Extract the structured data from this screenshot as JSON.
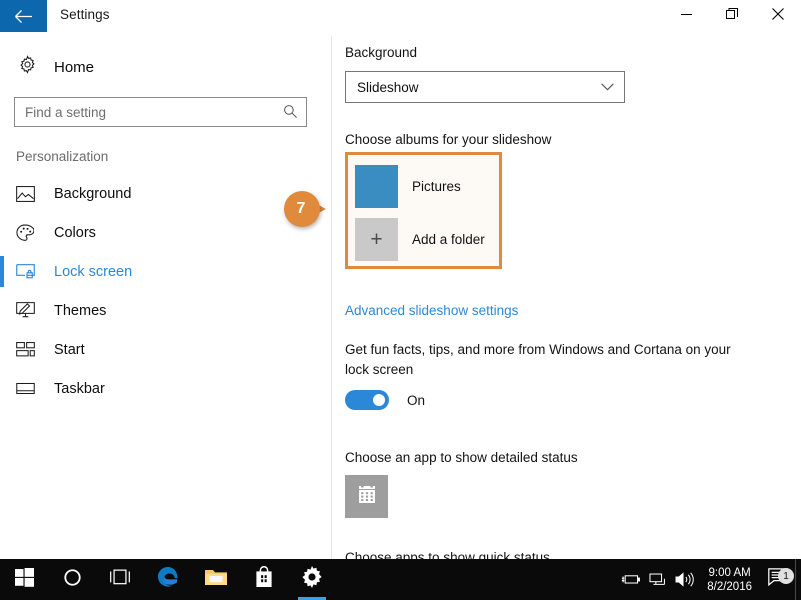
{
  "window": {
    "title": "Settings",
    "back_icon": "back-arrow-icon",
    "minimize_label": "Minimize",
    "restore_label": "Restore",
    "close_label": "Close"
  },
  "sidebar": {
    "home_label": "Home",
    "home_icon": "gear-icon",
    "search": {
      "placeholder": "Find a setting",
      "value": "",
      "icon": "search-icon"
    },
    "section_title": "Personalization",
    "items": [
      {
        "label": "Background",
        "icon": "picture-icon",
        "selected": false
      },
      {
        "label": "Colors",
        "icon": "palette-icon",
        "selected": false
      },
      {
        "label": "Lock screen",
        "icon": "lock-screen-icon",
        "selected": true
      },
      {
        "label": "Themes",
        "icon": "brush-icon",
        "selected": false
      },
      {
        "label": "Start",
        "icon": "start-tiles-icon",
        "selected": false
      },
      {
        "label": "Taskbar",
        "icon": "taskbar-icon",
        "selected": false
      }
    ]
  },
  "main": {
    "background_label": "Background",
    "background_select": {
      "value": "Slideshow",
      "chevron_icon": "chevron-down-icon"
    },
    "albums_label": "Choose albums for your slideshow",
    "albums": [
      {
        "label": "Pictures",
        "icon": "picture-thumbnail",
        "color": "#3a8dc0"
      },
      {
        "label": "Add a folder",
        "icon": "plus-icon",
        "color": "#c9c9c9"
      }
    ],
    "advanced_link": "Advanced slideshow settings",
    "cortana_text": "Get fun facts, tips, and more from Windows and Cortana on your lock screen",
    "cortana_toggle": {
      "state": "On",
      "on": true
    },
    "status_label": "Choose an app to show detailed status",
    "status_app_icon": "calendar-icon",
    "clipped_label": "Choose apps to show quick status"
  },
  "callout": {
    "number": "7",
    "color": "#e08a3c"
  },
  "taskbar": {
    "items": [
      {
        "name": "start-button",
        "icon": "windows-logo-icon",
        "active": false
      },
      {
        "name": "cortana-button",
        "icon": "circle-icon",
        "active": false
      },
      {
        "name": "task-view-button",
        "icon": "task-view-icon",
        "active": false
      },
      {
        "name": "edge-button",
        "icon": "edge-icon",
        "active": false
      },
      {
        "name": "file-explorer-button",
        "icon": "folder-icon",
        "active": false
      },
      {
        "name": "store-button",
        "icon": "store-bag-icon",
        "active": false
      },
      {
        "name": "settings-button",
        "icon": "gear-icon",
        "active": true
      }
    ],
    "tray": {
      "icons": [
        "battery-icon",
        "network-icon",
        "volume-icon"
      ],
      "time": "9:00 AM",
      "date": "8/2/2016",
      "action_center_icon": "action-center-icon",
      "notification_count": "1"
    }
  },
  "colors": {
    "accent_blue": "#2b88d8",
    "titlebar_blue": "#0d67ad",
    "callout_orange": "#e08a3c",
    "thumb_blue": "#3a8dc0"
  }
}
